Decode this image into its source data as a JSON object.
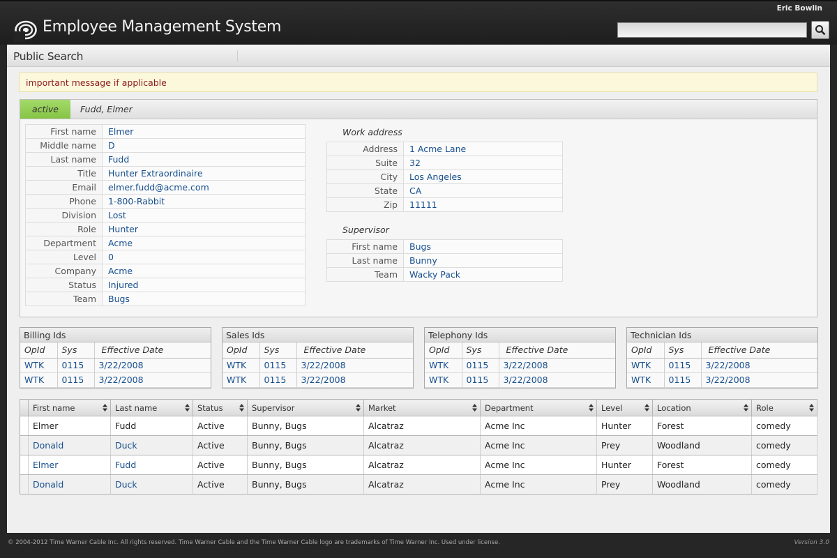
{
  "header": {
    "user_name": "Eric Bowlin",
    "app_title": "Employee Management System",
    "search_placeholder": ""
  },
  "page": {
    "title": "Public Search"
  },
  "alert": {
    "message": "important message if applicable"
  },
  "employee": {
    "status": "active",
    "display_name": "Fudd, Elmer",
    "fields": [
      {
        "label": "First name",
        "value": "Elmer"
      },
      {
        "label": "Middle name",
        "value": "D"
      },
      {
        "label": "Last name",
        "value": "Fudd"
      },
      {
        "label": "Title",
        "value": "Hunter Extraordinaire"
      },
      {
        "label": "Email",
        "value": "elmer.fudd@acme.com"
      },
      {
        "label": "Phone",
        "value": "1-800-Rabbit"
      },
      {
        "label": "Division",
        "value": "Lost"
      },
      {
        "label": "Role",
        "value": "Hunter"
      },
      {
        "label": "Department",
        "value": "Acme"
      },
      {
        "label": "Level",
        "value": "0"
      },
      {
        "label": "Company",
        "value": "Acme"
      },
      {
        "label": "Status",
        "value": "Injured"
      },
      {
        "label": "Team",
        "value": "Bugs"
      }
    ],
    "work_address": {
      "heading": "Work address",
      "fields": [
        {
          "label": "Address",
          "value": "1 Acme Lane"
        },
        {
          "label": "Suite",
          "value": "32"
        },
        {
          "label": "City",
          "value": "Los Angeles"
        },
        {
          "label": "State",
          "value": "CA"
        },
        {
          "label": "Zip",
          "value": "11111"
        }
      ]
    },
    "supervisor": {
      "heading": "Supervisor",
      "fields": [
        {
          "label": "First name",
          "value": "Bugs"
        },
        {
          "label": "Last name",
          "value": "Bunny"
        },
        {
          "label": "Team",
          "value": "Wacky Pack"
        }
      ]
    }
  },
  "id_tables": [
    {
      "title": "Billing Ids",
      "columns": [
        "OpId",
        "Sys",
        "Effective Date"
      ],
      "rows": [
        [
          "WTK",
          "0115",
          "3/22/2008"
        ],
        [
          "WTK",
          "0115",
          "3/22/2008"
        ]
      ]
    },
    {
      "title": "Sales Ids",
      "columns": [
        "OpId",
        "Sys",
        "Effective Date"
      ],
      "rows": [
        [
          "WTK",
          "0115",
          "3/22/2008"
        ],
        [
          "WTK",
          "0115",
          "3/22/2008"
        ]
      ]
    },
    {
      "title": "Telephony Ids",
      "columns": [
        "OpId",
        "Sys",
        "Effective Date"
      ],
      "rows": [
        [
          "WTK",
          "0115",
          "3/22/2008"
        ],
        [
          "WTK",
          "0115",
          "3/22/2008"
        ]
      ]
    },
    {
      "title": "Technician Ids",
      "columns": [
        "OpId",
        "Sys",
        "Effective Date"
      ],
      "rows": [
        [
          "WTK",
          "0115",
          "3/22/2008"
        ],
        [
          "WTK",
          "0115",
          "3/22/2008"
        ]
      ]
    }
  ],
  "results": {
    "columns": [
      "First name",
      "Last name",
      "Status",
      "Supervisor",
      "Market",
      "Department",
      "Level",
      "Location",
      "Role"
    ],
    "rows": [
      [
        "Elmer",
        "Fudd",
        "Active",
        "Bunny, Bugs",
        "Alcatraz",
        "Acme Inc",
        "Hunter",
        "Forest",
        "comedy"
      ],
      [
        "Donald",
        "Duck",
        "Active",
        "Bunny, Bugs",
        "Alcatraz",
        "Acme Inc",
        "Prey",
        "Woodland",
        "comedy"
      ],
      [
        "Elmer",
        "Fudd",
        "Active",
        "Bunny, Bugs",
        "Alcatraz",
        "Acme Inc",
        "Hunter",
        "Forest",
        "comedy"
      ],
      [
        "Donald",
        "Duck",
        "Active",
        "Bunny, Bugs",
        "Alcatraz",
        "Acme Inc",
        "Prey",
        "Woodland",
        "comedy"
      ]
    ]
  },
  "footer": {
    "copyright": "© 2004-2012 Time Warner Cable Inc. All rights reserved. Time Warner Cable and the Time Warner Cable logo are trademarks of Time Warner Inc. Used under license.",
    "version": "Version 3.0"
  },
  "icons": {
    "logo": "time-warner-cable-eye-logo",
    "search": "magnifier-icon",
    "sort": "sort-arrows-icon"
  },
  "colors": {
    "status_active": "#8fcb50",
    "link": "#174f8e",
    "alert_text": "#8b1a1a",
    "alert_bg": "#fcf8dc"
  }
}
